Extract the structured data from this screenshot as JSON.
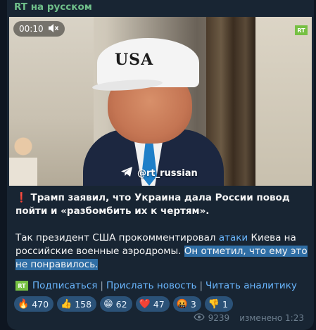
{
  "channel": {
    "name": "RT на русском"
  },
  "video": {
    "timer": "00:10",
    "badge": "RT",
    "cap_text": "USA",
    "watermark": "@rt_russian"
  },
  "post": {
    "headline_mark": "❗",
    "headline": "Трамп заявил, что Украина дала России повод пойти и «разбомбить их к чертям».",
    "body_pre": "Так президент США прокомментировал ",
    "body_link": "атаки",
    "body_mid": " Киева на российские военные аэродромы. ",
    "body_highlight": "Он отметил, что ему это не понравилось."
  },
  "links": {
    "badge": "RT",
    "subscribe": "Подписаться",
    "sep": "|",
    "send_news": "Прислать новость",
    "read_analytics": "Читать аналитику"
  },
  "reactions": [
    {
      "emoji": "🔥",
      "count": "470"
    },
    {
      "emoji": "👍",
      "count": "158"
    },
    {
      "emoji": "😁",
      "count": "62"
    },
    {
      "emoji": "❤️",
      "count": "47"
    },
    {
      "emoji": "🤬",
      "count": "3"
    },
    {
      "emoji": "👎",
      "count": "1"
    }
  ],
  "meta": {
    "views": "9239",
    "edited": "изменено 1:23"
  },
  "colors": {
    "accent": "#6ab7ff",
    "bubble": "#182533",
    "reaction_bg": "#2b5278",
    "channel_name": "#6fbf8a"
  }
}
